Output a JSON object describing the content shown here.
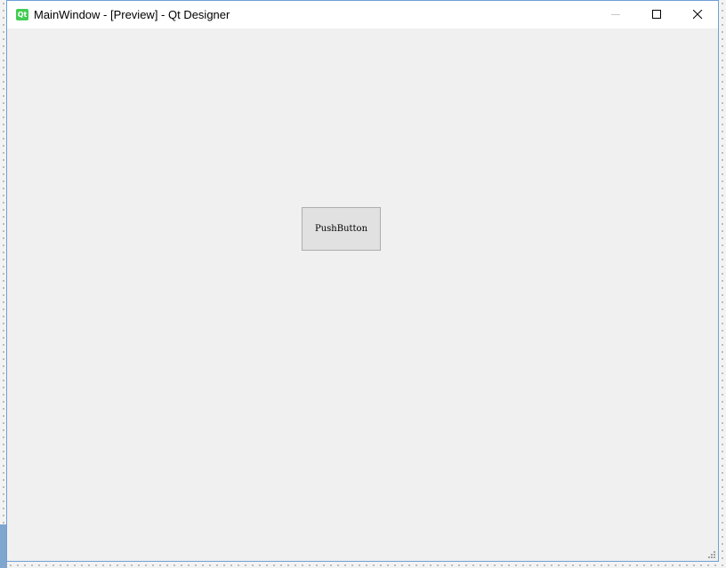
{
  "window": {
    "title": "MainWindow - [Preview] - Qt Designer",
    "app_icon_label": "Qt"
  },
  "controls": {
    "minimize": "minimize-icon",
    "maximize": "maximize-icon",
    "close": "close-icon"
  },
  "main": {
    "push_button_label": "PushButton"
  },
  "colors": {
    "titlebar": "#ffffff",
    "client_bg": "#f0f0f0",
    "button_bg": "#e1e1e1",
    "button_border": "#adadad",
    "window_border": "#6f9fd6",
    "qt_green": "#41cd52"
  }
}
